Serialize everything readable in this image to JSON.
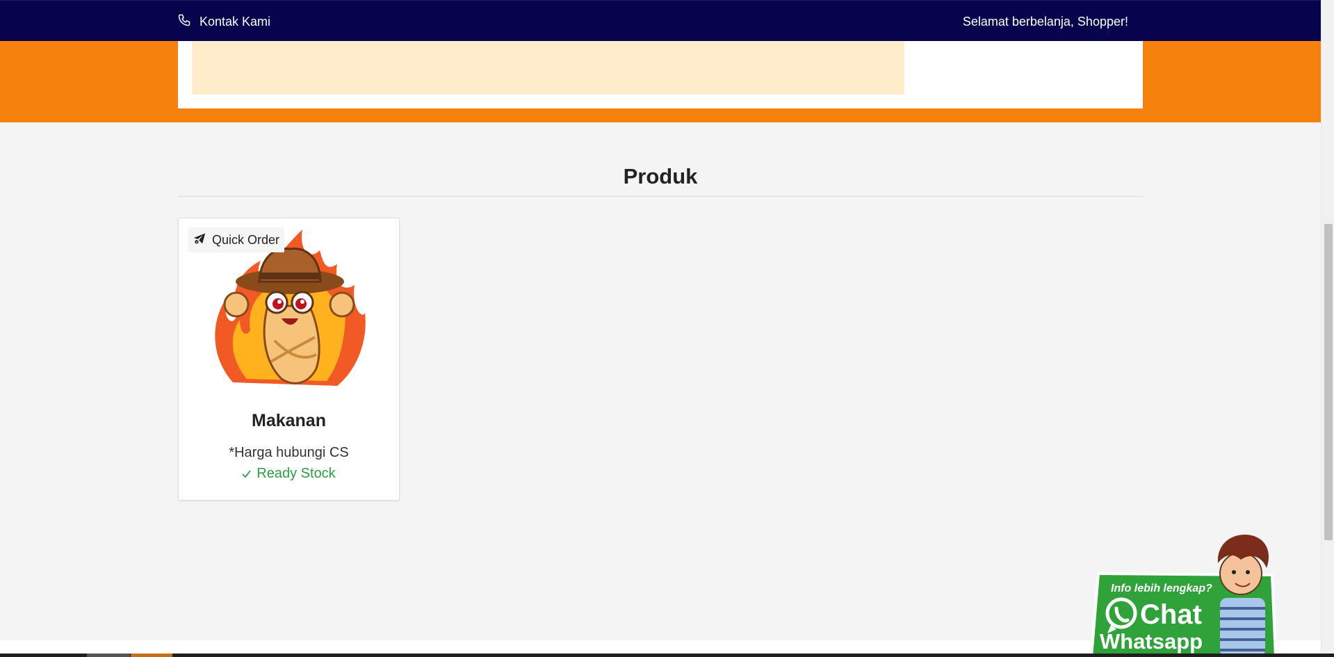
{
  "topbar": {
    "contact_label": "Kontak Kami",
    "contact_icon": "phone-icon",
    "greeting": "Selamat berbelanja, Shopper!"
  },
  "section": {
    "title": "Produk"
  },
  "products": [
    {
      "quick_order_label": "Quick Order",
      "quick_order_icon": "send-plane-icon",
      "name": "Makanan",
      "price": "*Harga hubungi CS",
      "stock_label": "Ready Stock",
      "stock_icon": "check-icon"
    }
  ],
  "whatsapp": {
    "tagline": "Info lebih lengkap?",
    "line1": "Chat",
    "line2": "Whatsapp"
  },
  "colors": {
    "topbar": "#07044e",
    "banner": "#f6810d",
    "in_stock": "#2e9e44",
    "whatsapp_green": "#2fa33a"
  }
}
